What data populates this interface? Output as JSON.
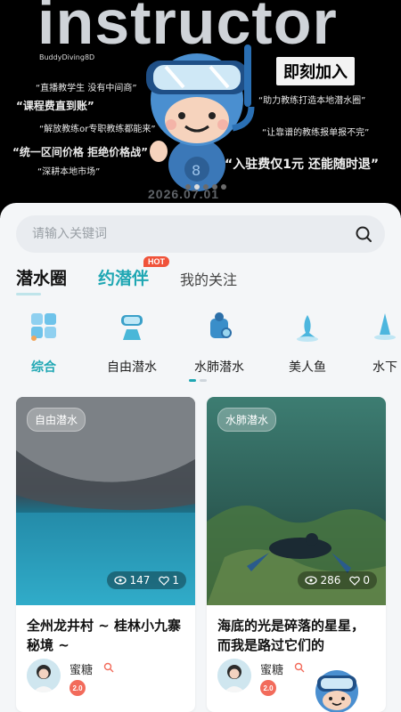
{
  "banner": {
    "title": "instructor",
    "brand": "BuddyDiving8D",
    "join_label": "即刻加入",
    "slogans": [
      "“直播教学生 没有中间商”",
      "“课程费直到账”",
      "“解放教练or专职教练都能来”",
      "“统一区间价格 拒绝价格战”",
      "“深耕本地市场”",
      "“助力教练打造本地潜水圈”",
      "“让靠谱的教练报单报不完”",
      "“入驻费仅1元 还能随时退”"
    ],
    "date": "2026.07.01"
  },
  "search": {
    "placeholder": "请输入关键词"
  },
  "tabs": [
    {
      "label": "潜水圈"
    },
    {
      "label": "约潜伴"
    },
    {
      "label": "我的关注"
    }
  ],
  "hot_badge": "HOT",
  "categories": [
    {
      "label": "综合",
      "icon": "grid-icon"
    },
    {
      "label": "自由潜水",
      "icon": "freedive-icon"
    },
    {
      "label": "水肺潜水",
      "icon": "scuba-icon"
    },
    {
      "label": "美人鱼",
      "icon": "mermaid-icon"
    },
    {
      "label": "水下",
      "icon": "underwater-icon"
    }
  ],
  "posts": [
    {
      "tag": "自由潜水",
      "views": "147",
      "likes": "1",
      "title": "全州龙井村 ~ 桂林小九寨秘境 ~",
      "author": "蜜糖",
      "level": "2.0"
    },
    {
      "tag": "水肺潜水",
      "views": "286",
      "likes": "0",
      "title": "海底的光是碎落的星星， 而我是路过它们的",
      "author": "蜜糖",
      "level": "2.0"
    }
  ],
  "colors": {
    "accent": "#1fa7b3",
    "hot": "#f0533a",
    "level_badge": "#f26b5b"
  }
}
